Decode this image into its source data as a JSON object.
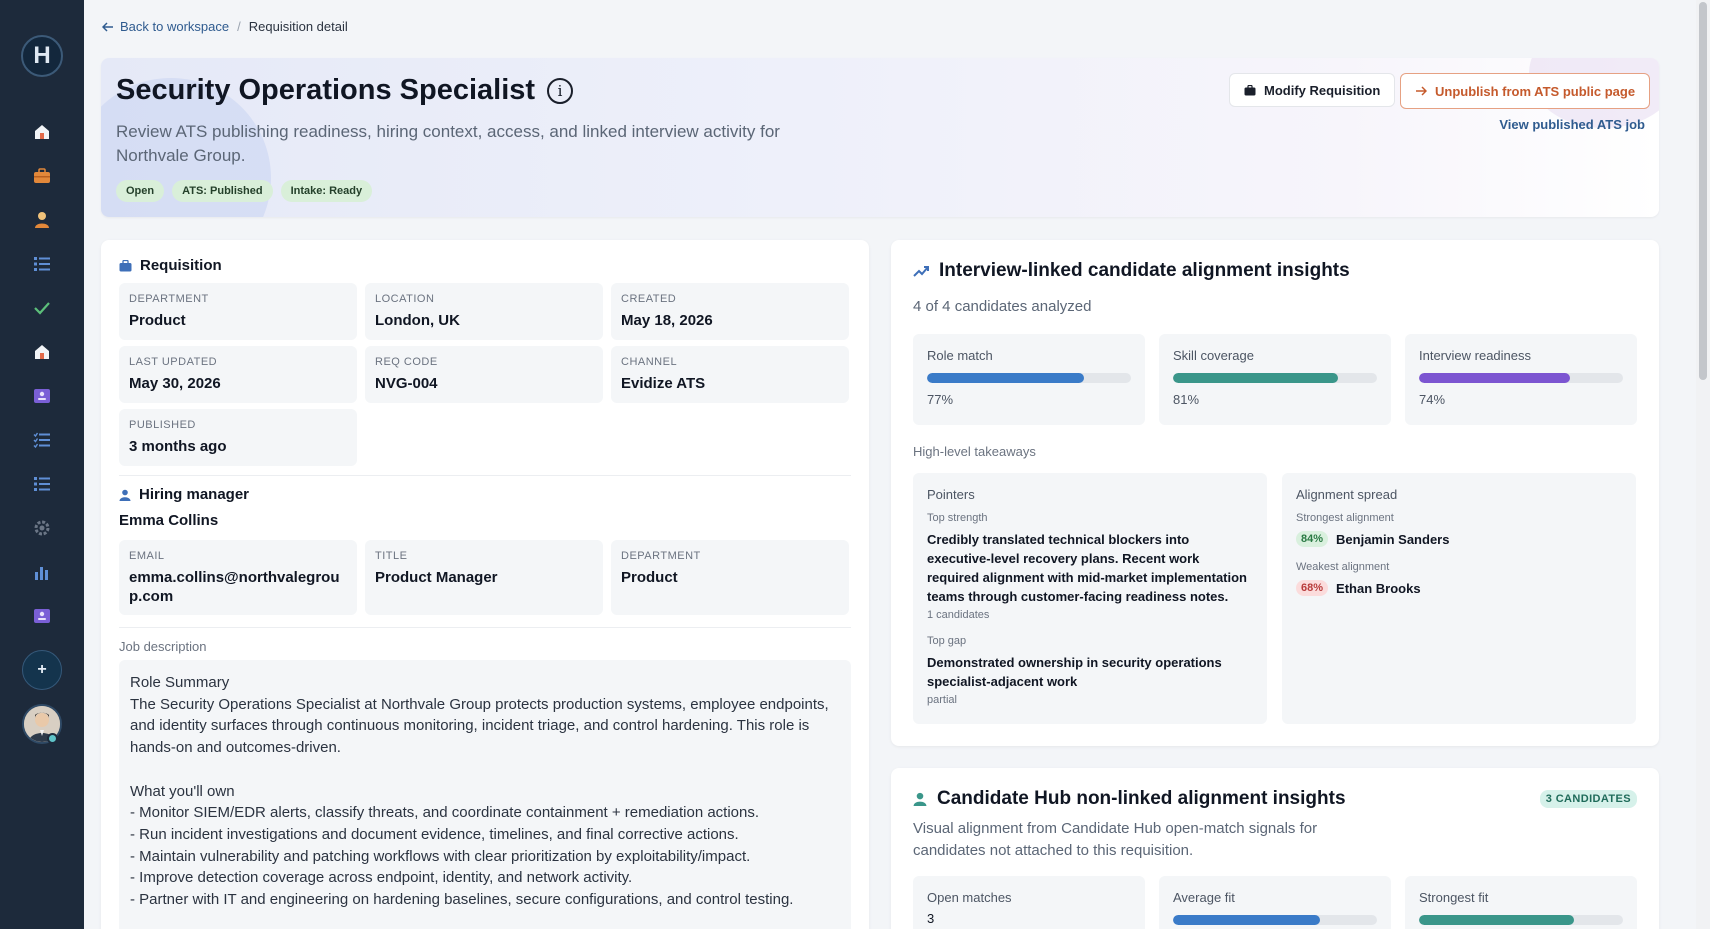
{
  "sidebar": {
    "logo": "H",
    "plus": "+",
    "icons": [
      "home-icon",
      "briefcase-icon",
      "person-icon",
      "list-icon",
      "check-icon",
      "home-icon",
      "id-card-icon",
      "checklist-icon",
      "list-icon",
      "gear-icon",
      "bar-chart-icon",
      "id-card-icon"
    ]
  },
  "breadcrumb": {
    "back": "Back to workspace",
    "sep": "/",
    "current": "Requisition detail"
  },
  "hero": {
    "title": "Security Operations Specialist",
    "info": "i",
    "subtitle": "Review ATS publishing readiness, hiring context, access, and linked interview activity for Northvale Group.",
    "badges": [
      "Open",
      "ATS: Published",
      "Intake: Ready"
    ],
    "modify": "Modify Requisition",
    "unpublish": "Unpublish from ATS public page",
    "view_link": "View published ATS job"
  },
  "requisition": {
    "heading": "Requisition",
    "fields": [
      {
        "label": "Department",
        "value": "Product"
      },
      {
        "label": "Location",
        "value": "London, UK"
      },
      {
        "label": "Created",
        "value": "May 18, 2026"
      },
      {
        "label": "Last updated",
        "value": "May 30, 2026"
      },
      {
        "label": "Req code",
        "value": "NVG-004"
      },
      {
        "label": "Channel",
        "value": "Evidize ATS"
      },
      {
        "label": "Published",
        "value": "3 months ago"
      }
    ]
  },
  "manager": {
    "heading": "Hiring manager",
    "name": "Emma Collins",
    "fields": [
      {
        "label": "Email",
        "value": "emma.collins@northvalegroup.com"
      },
      {
        "label": "Title",
        "value": "Product Manager"
      },
      {
        "label": "Department",
        "value": "Product"
      }
    ]
  },
  "job": {
    "label": "Job description",
    "text": "Role Summary\nThe Security Operations Specialist at Northvale Group protects production systems, employee endpoints, and identity surfaces through continuous monitoring, incident triage, and control hardening. This role is hands-on and outcomes-driven.\n\nWhat you'll own\n- Monitor SIEM/EDR alerts, classify threats, and coordinate containment + remediation actions.\n- Run incident investigations and document evidence, timelines, and final corrective actions.\n- Maintain vulnerability and patching workflows with clear prioritization by exploitability/impact.\n- Improve detection coverage across endpoint, identity, and network activity.\n- Partner with IT and engineering on hardening baselines, secure configurations, and control testing."
  },
  "insights": {
    "title": "Interview-linked candidate alignment insights",
    "subtitle": "4 of 4 candidates analyzed",
    "metrics": [
      {
        "label": "Role match",
        "value": 77,
        "display": "77%",
        "color": "#3a7bc8"
      },
      {
        "label": "Skill coverage",
        "value": 81,
        "display": "81%",
        "color": "#3a968a"
      },
      {
        "label": "Interview readiness",
        "value": 74,
        "display": "74%",
        "color": "#7c55d1"
      }
    ],
    "takeaways_label": "High-level takeaways",
    "pointers": {
      "heading": "Pointers",
      "strength_label": "Top strength",
      "strength": "Credibly translated technical blockers into executive-level recovery plans. Recent work required alignment with mid-market implementation teams through customer-facing readiness notes.",
      "strength_note": "1 candidates",
      "gap_label": "Top gap",
      "gap": "Demonstrated ownership in security operations specialist-adjacent work",
      "gap_note": "partial"
    },
    "spread": {
      "heading": "Alignment spread",
      "strongest_label": "Strongest alignment",
      "strongest_pct": "84%",
      "strongest_name": "Benjamin Sanders",
      "weakest_label": "Weakest alignment",
      "weakest_pct": "68%",
      "weakest_name": "Ethan Brooks"
    }
  },
  "hub": {
    "title": "Candidate Hub non-linked alignment insights",
    "pill": "3 CANDIDATES",
    "subtitle": "Visual alignment from Candidate Hub open-match signals for candidates not attached to this requisition.",
    "metrics": [
      {
        "label": "Open matches",
        "value": "3"
      },
      {
        "label": "Average fit",
        "bar": 72,
        "color": "#3a7bc8"
      },
      {
        "label": "Strongest fit",
        "bar": 76,
        "color": "#3a968a"
      }
    ]
  }
}
